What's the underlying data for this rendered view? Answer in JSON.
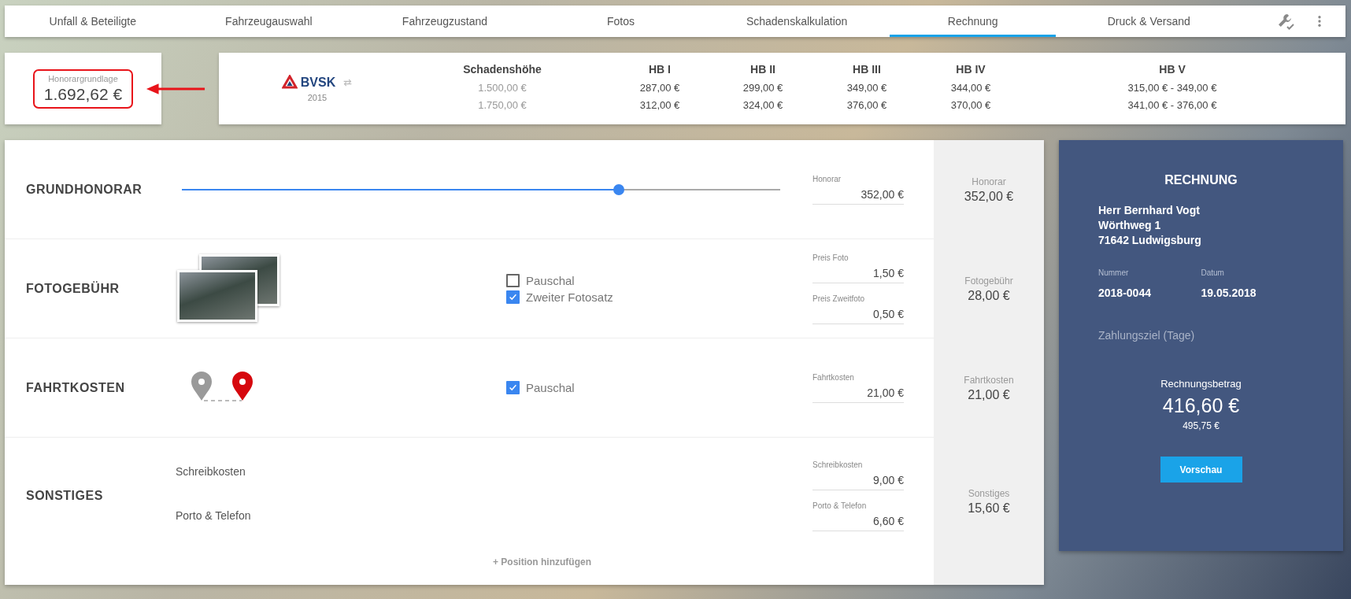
{
  "tabs": [
    {
      "label": "Unfall & Beteiligte",
      "selected": false
    },
    {
      "label": "Fahrzeugauswahl",
      "selected": false
    },
    {
      "label": "Fahrzeugzustand",
      "selected": false
    },
    {
      "label": "Fotos",
      "selected": false
    },
    {
      "label": "Schadenskalkulation",
      "selected": false
    },
    {
      "label": "Rechnung",
      "selected": true
    },
    {
      "label": "Druck & Versand",
      "selected": false
    }
  ],
  "base_fee": {
    "label": "Honorargrundlage",
    "value": "1.692,62 €"
  },
  "fee_table": {
    "logo_text": "BVSK",
    "year": "2015",
    "columns": [
      {
        "kind": "threshold",
        "header": "Schadenshöhe",
        "values": [
          "1.500,00 €",
          "1.750,00 €"
        ]
      },
      {
        "kind": "fee",
        "header": "HB I",
        "values": [
          "287,00 €",
          "312,00 €"
        ]
      },
      {
        "kind": "fee",
        "header": "HB II",
        "values": [
          "299,00 €",
          "324,00 €"
        ]
      },
      {
        "kind": "fee",
        "header": "HB III",
        "values": [
          "349,00 €",
          "376,00 €"
        ]
      },
      {
        "kind": "fee",
        "header": "HB IV",
        "values": [
          "344,00 €",
          "370,00 €"
        ]
      },
      {
        "kind": "fee",
        "header": "HB V",
        "values": [
          "315,00 € - 349,00 €",
          "341,00 € - 376,00 €"
        ]
      }
    ]
  },
  "sections": [
    {
      "kind": "slider",
      "title": "GRUNDHONORAR",
      "level": 0.73,
      "fields": [
        {
          "label": "Honorar",
          "value": "352,00 €"
        }
      ],
      "summary": {
        "label": "Honorar",
        "value": "352,00 €"
      }
    },
    {
      "kind": "photos",
      "title": "FOTOGEBÜHR",
      "options": [
        {
          "label": "Pauschal",
          "checked": false
        },
        {
          "label": "Zweiter Fotosatz",
          "checked": true
        }
      ],
      "fields": [
        {
          "label": "Preis Foto",
          "value": "1,50 €"
        },
        {
          "label": "Preis Zweitfoto",
          "value": "0,50 €"
        }
      ],
      "summary": {
        "label": "Fotogebühr",
        "value": "28,00 €"
      }
    },
    {
      "kind": "route",
      "title": "FAHRTKOSTEN",
      "options": [
        {
          "label": "Pauschal",
          "checked": true
        }
      ],
      "fields": [
        {
          "label": "Fahrtkosten",
          "value": "21,00 €"
        }
      ],
      "summary": {
        "label": "Fahrtkosten",
        "value": "21,00 €"
      }
    },
    {
      "kind": "list",
      "title": "SONSTIGES",
      "items": [
        "Schreibkosten",
        "Porto & Telefon"
      ],
      "add_link": "+ Position hinzufügen",
      "fields": [
        {
          "label": "Schreibkosten",
          "value": "9,00 €"
        },
        {
          "label": "Porto & Telefon",
          "value": "6,60 €"
        }
      ],
      "summary": {
        "label": "Sonstiges",
        "value": "15,60 €"
      }
    }
  ],
  "invoice": {
    "title": "RECHNUNG",
    "address": [
      "Herr Bernhard Vogt",
      "Wörthweg 1",
      "71642 Ludwigsburg"
    ],
    "number_label": "Nummer",
    "number": "2018-0044",
    "date_label": "Datum",
    "date": "19.05.2018",
    "payment_term": {
      "placeholder": "Zahlungsziel (Tage)"
    },
    "amount_label": "Rechnungsbetrag",
    "amount": "416,60 €",
    "gross": "495,75 €",
    "button": "Vorschau"
  }
}
